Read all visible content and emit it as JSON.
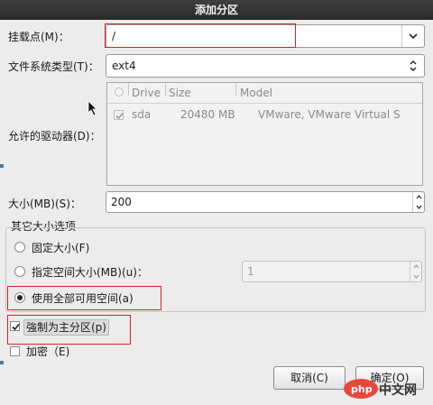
{
  "window": {
    "title": "添加分区"
  },
  "mount_point": {
    "label": "挂载点(M)：",
    "value": "/"
  },
  "fs_type": {
    "label": "文件系统类型(T)：",
    "value": "ext4"
  },
  "drives": {
    "label": "允许的驱动器(D)：",
    "columns": [
      "Drive",
      "Size",
      "Model"
    ],
    "rows": [
      {
        "drive": "sda",
        "size": "20480 MB",
        "model": "VMware, VMware Virtual S"
      }
    ]
  },
  "size": {
    "label": "大小(MB)(S)：",
    "value": "200"
  },
  "other_options": {
    "title": "其它大小选项",
    "fixed": "固定大小(F)",
    "fill_to": "指定空间大小(MB)(u)：",
    "fill_to_value": "1",
    "fill_all": "使用全部可用空间(a)"
  },
  "primary": {
    "label": "強制为主分区(p)"
  },
  "encrypt": {
    "label": "加密（E)"
  },
  "buttons": {
    "cancel": "取消(C)",
    "ok": "确定(O)"
  },
  "watermark": {
    "text": "中文网",
    "logo": "php"
  }
}
